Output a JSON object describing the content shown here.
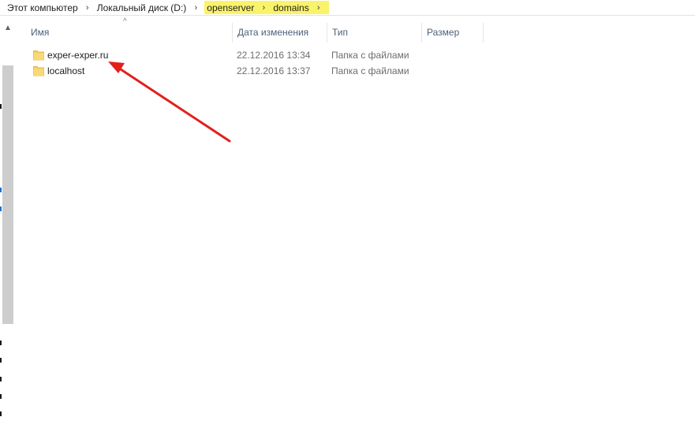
{
  "breadcrumb": {
    "items": [
      {
        "label": "Этот компьютер",
        "highlighted": false
      },
      {
        "label": "Локальный диск (D:)",
        "highlighted": false
      },
      {
        "label": "openserver",
        "highlighted": true
      },
      {
        "label": "domains",
        "highlighted": true
      }
    ],
    "separator_icon": "chevron-right-icon",
    "highlight_color": "#faf36a"
  },
  "columns": {
    "name": "Имя",
    "date": "Дата изменения",
    "type": "Тип",
    "size": "Размер",
    "sort_icon": "sort-ascending-icon"
  },
  "files": [
    {
      "name": "exper-exper.ru",
      "date": "22.12.2016 13:34",
      "type": "Папка с файлами",
      "size": "",
      "icon": "folder-icon"
    },
    {
      "name": "localhost",
      "date": "22.12.2016 13:37",
      "type": "Папка с файлами",
      "size": "",
      "icon": "folder-icon"
    }
  ],
  "colors": {
    "header_text": "#4c607a",
    "secondary_text": "#6d6d6d",
    "folder": "#f5cf5b",
    "annotation_arrow": "#e3201b"
  }
}
